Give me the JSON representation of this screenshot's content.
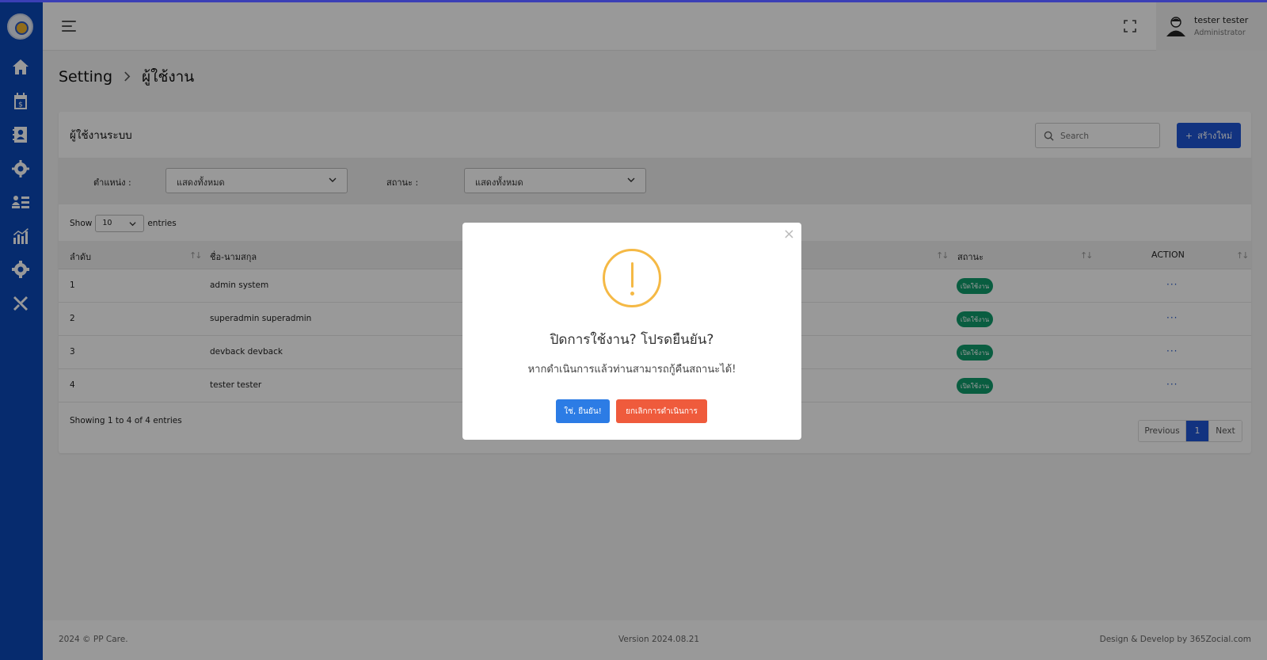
{
  "header": {
    "user_name": "tester tester",
    "user_role": "Administrator"
  },
  "sidebar": {
    "icons": [
      "home-icon",
      "calendar-dollar-icon",
      "contacts-icon",
      "users-gear-icon",
      "user-list-icon",
      "chart-icon",
      "settings-icon",
      "tools-icon"
    ]
  },
  "breadcrumb": {
    "parent": "Setting",
    "current": "ผู้ใช้งาน"
  },
  "card": {
    "title": "ผู้ใช้งานระบบ",
    "search_placeholder": "Search",
    "create_label": "สร้างใหม่"
  },
  "filters": {
    "position_label": "ตำแหน่ง :",
    "position_value": "แสดงทั้งหมด",
    "status_label": "สถานะ :",
    "status_value": "แสดงทั้งหมด"
  },
  "length_menu": {
    "show": "Show",
    "value": "10",
    "entries": "entries"
  },
  "table": {
    "columns": {
      "no": "ลำดับ",
      "name": "ชื่อ-นามสกุล",
      "status": "สถานะ",
      "action": "ACTION"
    },
    "rows": [
      {
        "no": "1",
        "name": "admin system",
        "status": "เปิดใช้งาน",
        "action": "···"
      },
      {
        "no": "2",
        "name": "superadmin superadmin",
        "status": "เปิดใช้งาน",
        "action": "···"
      },
      {
        "no": "3",
        "name": "devback devback",
        "status": "เปิดใช้งาน",
        "action": "···"
      },
      {
        "no": "4",
        "name": "tester tester",
        "status": "เปิดใช้งาน",
        "action": "···"
      }
    ],
    "info": "Showing 1 to 4 of 4 entries"
  },
  "pagination": {
    "previous": "Previous",
    "current": "1",
    "next": "Next"
  },
  "footer": {
    "copyright": "2024 © PP Care.",
    "version": "Version 2024.08.21",
    "credit": "Design & Develop by 365Zocial.com"
  },
  "modal": {
    "close": "×",
    "title": "ปิดการใช้งาน? โปรดยืนยัน?",
    "text": "หากดำเนินการแล้วท่านสามารถกู้คืนสถานะได้!",
    "confirm_label": "ใช่, ยืนยัน!",
    "cancel_label": "ยกเลิกการดำเนินการ"
  },
  "colors": {
    "sidebar": "#0b48b8",
    "primary": "#1e56d6",
    "success_badge": "#0f9b6c",
    "warning": "#f5b945",
    "danger": "#ef5b3c",
    "confirm": "#2c7ce5"
  }
}
